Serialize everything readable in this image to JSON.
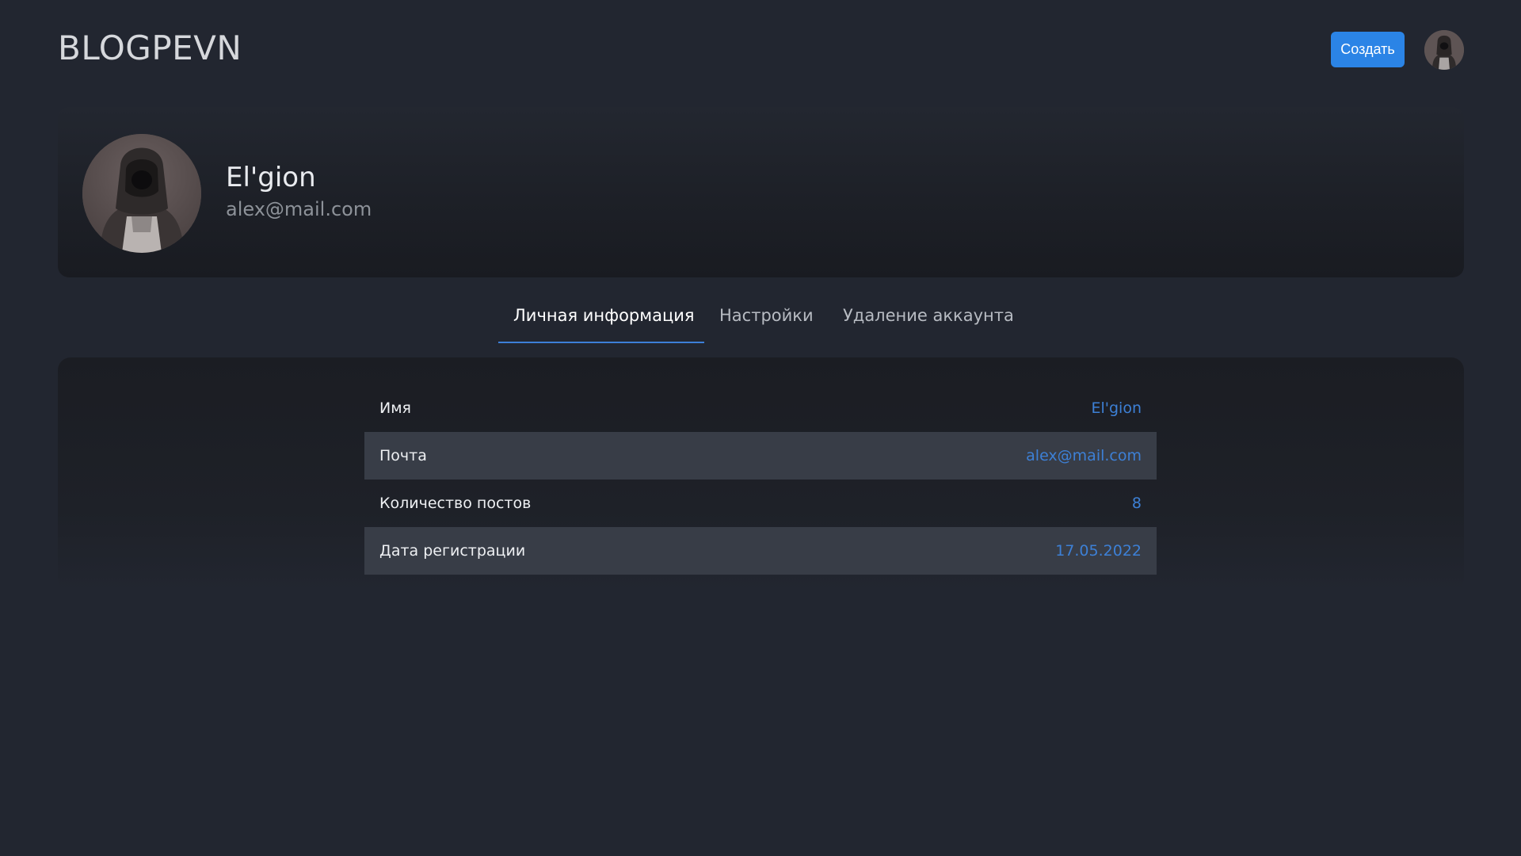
{
  "header": {
    "logo": "BLOGPEVN",
    "create_label": "Создать"
  },
  "profile": {
    "name": "El'gion",
    "email": "alex@mail.com"
  },
  "tabs": [
    {
      "label": "Личная информация",
      "active": true
    },
    {
      "label": "Настройки",
      "active": false
    },
    {
      "label": "Удаление аккаунта",
      "active": false
    }
  ],
  "info": {
    "rows": [
      {
        "label": "Имя",
        "value": "El'gion"
      },
      {
        "label": "Почта",
        "value": "alex@mail.com"
      },
      {
        "label": "Количество постов",
        "value": "8"
      },
      {
        "label": "Дата регистрации",
        "value": "17.05.2022"
      }
    ]
  },
  "colors": {
    "background": "#222630",
    "accent": "#2b84e6",
    "value_text": "#3d80d6",
    "striped_row": "#383d47"
  },
  "icons": {
    "header_avatar": "hooded-figure-avatar",
    "profile_avatar": "hooded-figure-avatar"
  }
}
